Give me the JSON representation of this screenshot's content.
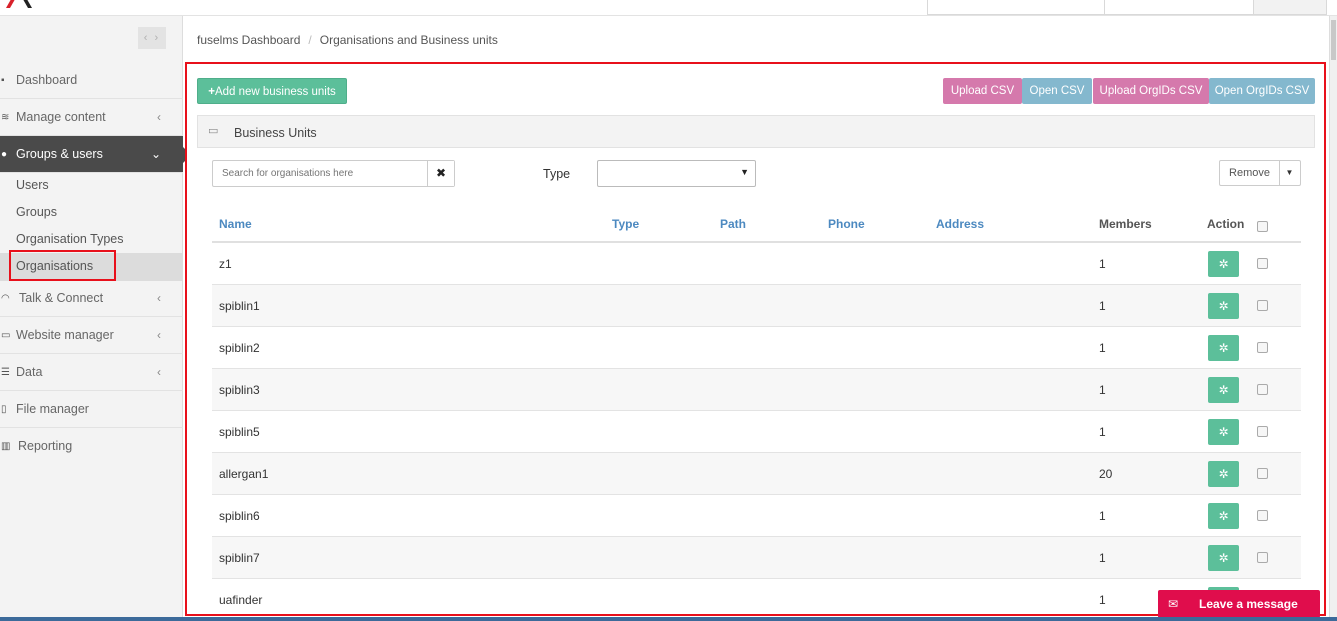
{
  "sidebar": {
    "collapse_glyph": "‹ ›",
    "items": [
      {
        "label": "Dashboard",
        "icon": "dashboard-icon",
        "glyph": "▪"
      },
      {
        "label": "Manage content",
        "icon": "layers-icon",
        "glyph": "≋",
        "chevron": "‹"
      },
      {
        "label": "Groups & users",
        "icon": "user-icon",
        "glyph": "●",
        "chevron": "⌄"
      },
      {
        "label": "Talk & Connect",
        "icon": "wifi-icon",
        "glyph": "◠",
        "chevron": "‹"
      },
      {
        "label": "Website manager",
        "icon": "laptop-icon",
        "glyph": "▭",
        "chevron": "‹"
      },
      {
        "label": "Data",
        "icon": "database-icon",
        "glyph": "☰",
        "chevron": "‹"
      },
      {
        "label": "File manager",
        "icon": "file-icon",
        "glyph": "▯"
      },
      {
        "label": "Reporting",
        "icon": "bar-chart-icon",
        "glyph": "▥"
      }
    ],
    "sub_items": [
      "Users",
      "Groups",
      "Organisation Types",
      "Organisations"
    ]
  },
  "breadcrumb": {
    "home": "fuselms Dashboard",
    "separator": "/",
    "current": "Organisations and Business units"
  },
  "toolbar": {
    "add_label": "Add new business units",
    "add_icon": "+",
    "upload_csv": "Upload CSV",
    "open_csv": "Open CSV",
    "upload_orgids_csv": "Upload OrgIDs CSV",
    "open_orgids_csv": "Open OrgIDs CSV"
  },
  "panel": {
    "title": "Business Units",
    "icon_glyph": "▭"
  },
  "filters": {
    "search_placeholder": "Search for organisations here",
    "clear_glyph": "✖",
    "type_label": "Type",
    "type_value": "",
    "type_caret": "▼",
    "remove_label": "Remove",
    "remove_caret": "▼"
  },
  "table": {
    "columns": {
      "name": "Name",
      "type": "Type",
      "path": "Path",
      "phone": "Phone",
      "address": "Address",
      "members": "Members",
      "action": "Action"
    },
    "gear_glyph": "✲",
    "rows": [
      {
        "name": "z1",
        "members": "1"
      },
      {
        "name": "spiblin1",
        "members": "1"
      },
      {
        "name": "spiblin2",
        "members": "1"
      },
      {
        "name": "spiblin3",
        "members": "1"
      },
      {
        "name": "spiblin5",
        "members": "1"
      },
      {
        "name": "allergan1",
        "members": "20"
      },
      {
        "name": "spiblin6",
        "members": "1"
      },
      {
        "name": "spiblin7",
        "members": "1"
      },
      {
        "name": "uafinder",
        "members": "1"
      }
    ]
  },
  "chat": {
    "label": "Leave a message",
    "icon_glyph": "✉"
  },
  "colors": {
    "accent_green": "#5cbf9a",
    "pink": "#d579ac",
    "blue": "#84b8ce",
    "highlight_red": "#e8101b",
    "chat_red": "#e00d4c",
    "active_nav": "#4a4a4a"
  }
}
